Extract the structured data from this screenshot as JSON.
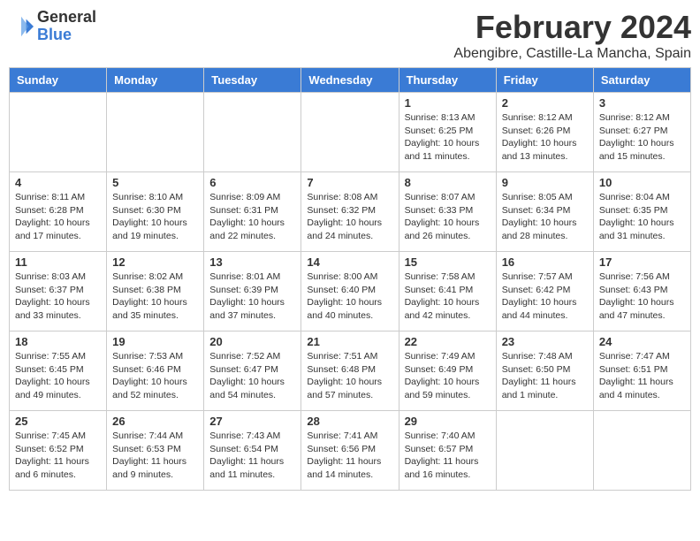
{
  "header": {
    "logo_general": "General",
    "logo_blue": "Blue",
    "title": "February 2024",
    "subtitle": "Abengibre, Castille-La Mancha, Spain"
  },
  "days_of_week": [
    "Sunday",
    "Monday",
    "Tuesday",
    "Wednesday",
    "Thursday",
    "Friday",
    "Saturday"
  ],
  "weeks": [
    [
      {
        "day": "",
        "info": ""
      },
      {
        "day": "",
        "info": ""
      },
      {
        "day": "",
        "info": ""
      },
      {
        "day": "",
        "info": ""
      },
      {
        "day": "1",
        "info": "Sunrise: 8:13 AM\nSunset: 6:25 PM\nDaylight: 10 hours\nand 11 minutes."
      },
      {
        "day": "2",
        "info": "Sunrise: 8:12 AM\nSunset: 6:26 PM\nDaylight: 10 hours\nand 13 minutes."
      },
      {
        "day": "3",
        "info": "Sunrise: 8:12 AM\nSunset: 6:27 PM\nDaylight: 10 hours\nand 15 minutes."
      }
    ],
    [
      {
        "day": "4",
        "info": "Sunrise: 8:11 AM\nSunset: 6:28 PM\nDaylight: 10 hours\nand 17 minutes."
      },
      {
        "day": "5",
        "info": "Sunrise: 8:10 AM\nSunset: 6:30 PM\nDaylight: 10 hours\nand 19 minutes."
      },
      {
        "day": "6",
        "info": "Sunrise: 8:09 AM\nSunset: 6:31 PM\nDaylight: 10 hours\nand 22 minutes."
      },
      {
        "day": "7",
        "info": "Sunrise: 8:08 AM\nSunset: 6:32 PM\nDaylight: 10 hours\nand 24 minutes."
      },
      {
        "day": "8",
        "info": "Sunrise: 8:07 AM\nSunset: 6:33 PM\nDaylight: 10 hours\nand 26 minutes."
      },
      {
        "day": "9",
        "info": "Sunrise: 8:05 AM\nSunset: 6:34 PM\nDaylight: 10 hours\nand 28 minutes."
      },
      {
        "day": "10",
        "info": "Sunrise: 8:04 AM\nSunset: 6:35 PM\nDaylight: 10 hours\nand 31 minutes."
      }
    ],
    [
      {
        "day": "11",
        "info": "Sunrise: 8:03 AM\nSunset: 6:37 PM\nDaylight: 10 hours\nand 33 minutes."
      },
      {
        "day": "12",
        "info": "Sunrise: 8:02 AM\nSunset: 6:38 PM\nDaylight: 10 hours\nand 35 minutes."
      },
      {
        "day": "13",
        "info": "Sunrise: 8:01 AM\nSunset: 6:39 PM\nDaylight: 10 hours\nand 37 minutes."
      },
      {
        "day": "14",
        "info": "Sunrise: 8:00 AM\nSunset: 6:40 PM\nDaylight: 10 hours\nand 40 minutes."
      },
      {
        "day": "15",
        "info": "Sunrise: 7:58 AM\nSunset: 6:41 PM\nDaylight: 10 hours\nand 42 minutes."
      },
      {
        "day": "16",
        "info": "Sunrise: 7:57 AM\nSunset: 6:42 PM\nDaylight: 10 hours\nand 44 minutes."
      },
      {
        "day": "17",
        "info": "Sunrise: 7:56 AM\nSunset: 6:43 PM\nDaylight: 10 hours\nand 47 minutes."
      }
    ],
    [
      {
        "day": "18",
        "info": "Sunrise: 7:55 AM\nSunset: 6:45 PM\nDaylight: 10 hours\nand 49 minutes."
      },
      {
        "day": "19",
        "info": "Sunrise: 7:53 AM\nSunset: 6:46 PM\nDaylight: 10 hours\nand 52 minutes."
      },
      {
        "day": "20",
        "info": "Sunrise: 7:52 AM\nSunset: 6:47 PM\nDaylight: 10 hours\nand 54 minutes."
      },
      {
        "day": "21",
        "info": "Sunrise: 7:51 AM\nSunset: 6:48 PM\nDaylight: 10 hours\nand 57 minutes."
      },
      {
        "day": "22",
        "info": "Sunrise: 7:49 AM\nSunset: 6:49 PM\nDaylight: 10 hours\nand 59 minutes."
      },
      {
        "day": "23",
        "info": "Sunrise: 7:48 AM\nSunset: 6:50 PM\nDaylight: 11 hours\nand 1 minute."
      },
      {
        "day": "24",
        "info": "Sunrise: 7:47 AM\nSunset: 6:51 PM\nDaylight: 11 hours\nand 4 minutes."
      }
    ],
    [
      {
        "day": "25",
        "info": "Sunrise: 7:45 AM\nSunset: 6:52 PM\nDaylight: 11 hours\nand 6 minutes."
      },
      {
        "day": "26",
        "info": "Sunrise: 7:44 AM\nSunset: 6:53 PM\nDaylight: 11 hours\nand 9 minutes."
      },
      {
        "day": "27",
        "info": "Sunrise: 7:43 AM\nSunset: 6:54 PM\nDaylight: 11 hours\nand 11 minutes."
      },
      {
        "day": "28",
        "info": "Sunrise: 7:41 AM\nSunset: 6:56 PM\nDaylight: 11 hours\nand 14 minutes."
      },
      {
        "day": "29",
        "info": "Sunrise: 7:40 AM\nSunset: 6:57 PM\nDaylight: 11 hours\nand 16 minutes."
      },
      {
        "day": "",
        "info": ""
      },
      {
        "day": "",
        "info": ""
      }
    ]
  ]
}
